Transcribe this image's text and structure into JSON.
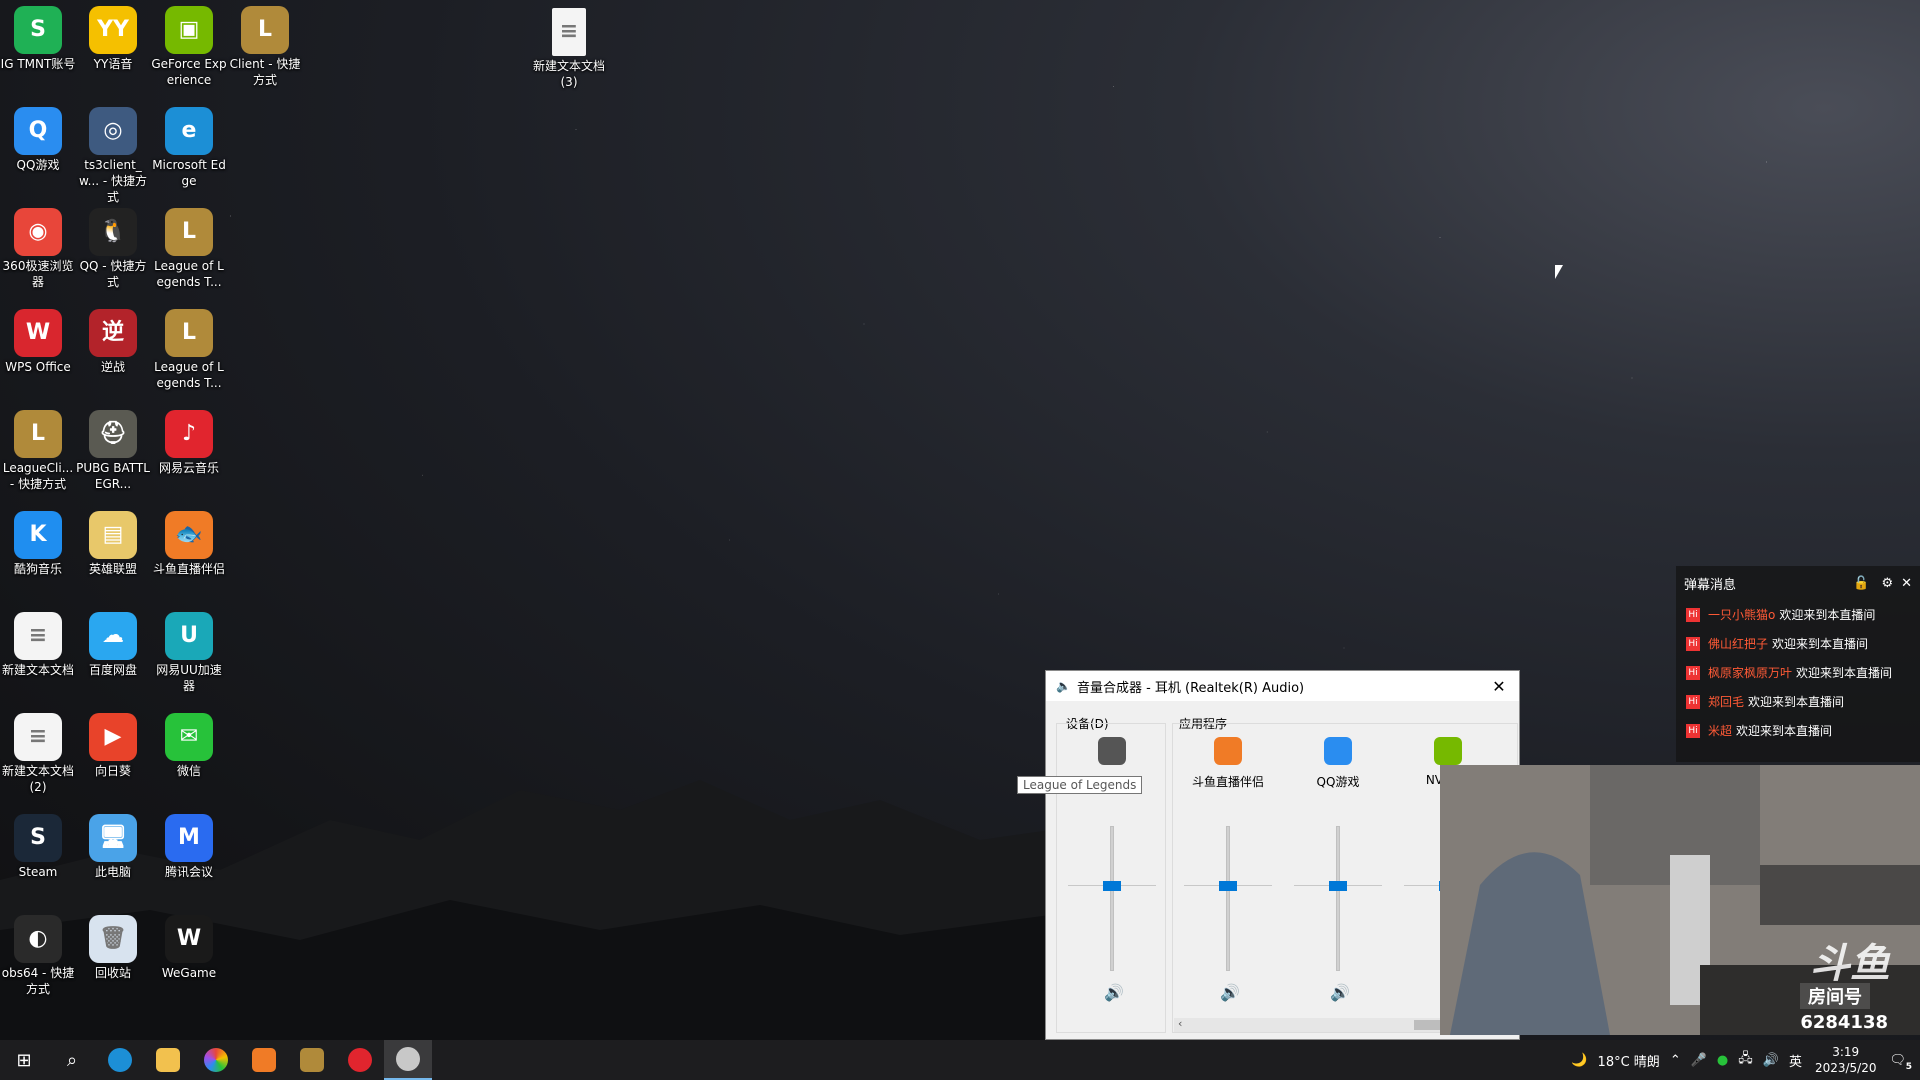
{
  "desktop": {
    "icons": [
      {
        "label": "IG TMNT账号",
        "color": "#1fb155",
        "glyph": "S"
      },
      {
        "label": "YY语音",
        "color": "#f5c000",
        "glyph": "YY"
      },
      {
        "label": "GeForce Experience",
        "color": "#76b900",
        "glyph": "▣"
      },
      {
        "label": "Client - 快捷方式",
        "color": "#b08a3a",
        "glyph": "L"
      },
      {
        "label": "QQ游戏",
        "color": "#2a8df0",
        "glyph": "Q"
      },
      {
        "label": "ts3client_w... - 快捷方式",
        "color": "#3e5a80",
        "glyph": "◎"
      },
      {
        "label": "Microsoft Edge",
        "color": "#1c8fd6",
        "glyph": "e"
      },
      {
        "label": "360极速浏览器",
        "color": "#e8463a",
        "glyph": "◉"
      },
      {
        "label": "QQ - 快捷方式",
        "color": "#222222",
        "glyph": "🐧"
      },
      {
        "label": "League of Legends T...",
        "color": "#b08a3a",
        "glyph": "L"
      },
      {
        "label": "WPS Office",
        "color": "#d9262e",
        "glyph": "W"
      },
      {
        "label": "逆战",
        "color": "#b3232a",
        "glyph": "逆"
      },
      {
        "label": "League of Legends T...",
        "color": "#b08a3a",
        "glyph": "L"
      },
      {
        "label": "LeagueCli... - 快捷方式",
        "color": "#b08a3a",
        "glyph": "L"
      },
      {
        "label": "PUBG BATTLEGR...",
        "color": "#5a5a52",
        "glyph": "⛑"
      },
      {
        "label": "网易云音乐",
        "color": "#e1252e",
        "glyph": "♪"
      },
      {
        "label": "酷狗音乐",
        "color": "#1f8ef0",
        "glyph": "K"
      },
      {
        "label": "英雄联盟",
        "color": "#e8c86a",
        "glyph": "▤"
      },
      {
        "label": "斗鱼直播伴侣",
        "color": "#f07b26",
        "glyph": "🐟"
      },
      {
        "label": "新建文本文档",
        "color": "#f4f4f4",
        "glyph": "≡"
      },
      {
        "label": "百度网盘",
        "color": "#2aa7f0",
        "glyph": "☁"
      },
      {
        "label": "网易UU加速器",
        "color": "#1aa8b8",
        "glyph": "U"
      },
      {
        "label": "新建文本文档 (2)",
        "color": "#f4f4f4",
        "glyph": "≡"
      },
      {
        "label": "向日葵",
        "color": "#e8432a",
        "glyph": "▶"
      },
      {
        "label": "微信",
        "color": "#27c23a",
        "glyph": "✉"
      },
      {
        "label": "Steam",
        "color": "#1b2838",
        "glyph": "S"
      },
      {
        "label": "此电脑",
        "color": "#4aa3e8",
        "glyph": "🖥"
      },
      {
        "label": "腾讯会议",
        "color": "#2a6bf0",
        "glyph": "M"
      },
      {
        "label": "obs64 - 快捷方式",
        "color": "#2a2a2a",
        "glyph": "◐"
      },
      {
        "label": "回收站",
        "color": "#d8e3ef",
        "glyph": "🗑"
      },
      {
        "label": "WeGame",
        "color": "#1a1a1a",
        "glyph": "W"
      }
    ],
    "extra_icon": {
      "label": "新建文本文档 (3)",
      "color": "#f4f4f4",
      "glyph": "≡"
    }
  },
  "mixer": {
    "title": "音量合成器 - 耳机 (Realtek(R) Audio)",
    "device_group": "设备(D)",
    "apps_group": "应用程序",
    "tooltip": "League of Legends",
    "channels": [
      {
        "name": "",
        "level": 0.62,
        "icon": "headphones-icon"
      },
      {
        "name": "斗鱼直播伴侣",
        "level": 0.62,
        "icon": "douyu-icon"
      },
      {
        "name": "QQ游戏",
        "level": 0.62,
        "icon": "qqgame-icon"
      },
      {
        "name": "NV Con",
        "level": 0.62,
        "icon": "nvidia-icon"
      }
    ]
  },
  "danmu": {
    "title": "弹幕消息",
    "messages": [
      {
        "user": "一只小熊猫o",
        "text": "欢迎来到本直播间"
      },
      {
        "user": "佛山红把子",
        "text": "欢迎来到本直播间"
      },
      {
        "user": "枫原家枫原万叶",
        "text": "欢迎来到本直播间"
      },
      {
        "user": "郑回毛",
        "text": "欢迎来到本直播间"
      },
      {
        "user": "米超",
        "text": "欢迎来到本直播间"
      }
    ]
  },
  "webcam": {
    "brand": "斗鱼",
    "room_label": "房间号",
    "room_number": "6284138"
  },
  "taskbar": {
    "weather": "18°C 晴朗",
    "ime": "英",
    "time": "3:19",
    "date": "2023/5/20",
    "notifications": "5"
  }
}
